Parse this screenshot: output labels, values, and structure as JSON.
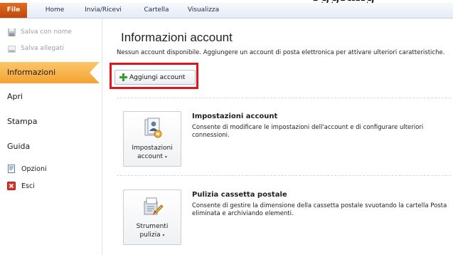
{
  "top_text": "oggiung",
  "ribbon": {
    "tabs": [
      {
        "label": "File"
      },
      {
        "label": "Home"
      },
      {
        "label": "Invia/Ricevi"
      },
      {
        "label": "Cartella"
      },
      {
        "label": "Visualizza"
      }
    ]
  },
  "nav": {
    "save_as": "Salva con nome",
    "save_attachments": "Salva allegati",
    "info": "Informazioni",
    "open": "Apri",
    "print": "Stampa",
    "help": "Guida",
    "options": "Opzioni",
    "exit": "Esci"
  },
  "main": {
    "title": "Informazioni account",
    "description": "Nessun account disponibile. Aggiungere un account di posta elettronica per attivare ulteriori caratteristiche.",
    "add_account": "Aggiungi account",
    "account_settings": {
      "button_line1": "Impostazioni",
      "button_line2": "account",
      "heading": "Impostazioni account",
      "text": "Consente di modificare le impostazioni dell'account e di configurare ulteriori connessioni."
    },
    "cleanup": {
      "button_line1": "Strumenti",
      "button_line2": "pulizia",
      "heading": "Pulizia cassetta postale",
      "text": "Consente di gestire la dimensione della cassetta postale svuotando la cartella Posta eliminata e archiviando elementi."
    }
  },
  "colors": {
    "file_tab": "#c85012",
    "nav_active": "#f4a22f",
    "highlight": "#e1141d",
    "plus_icon": "#3a9d29"
  },
  "icons": [
    "save-as-icon",
    "save-attachments-icon",
    "options-icon",
    "exit-icon",
    "plus-icon",
    "account-settings-icon",
    "cleanup-tools-icon",
    "dropdown-arrow-icon"
  ]
}
